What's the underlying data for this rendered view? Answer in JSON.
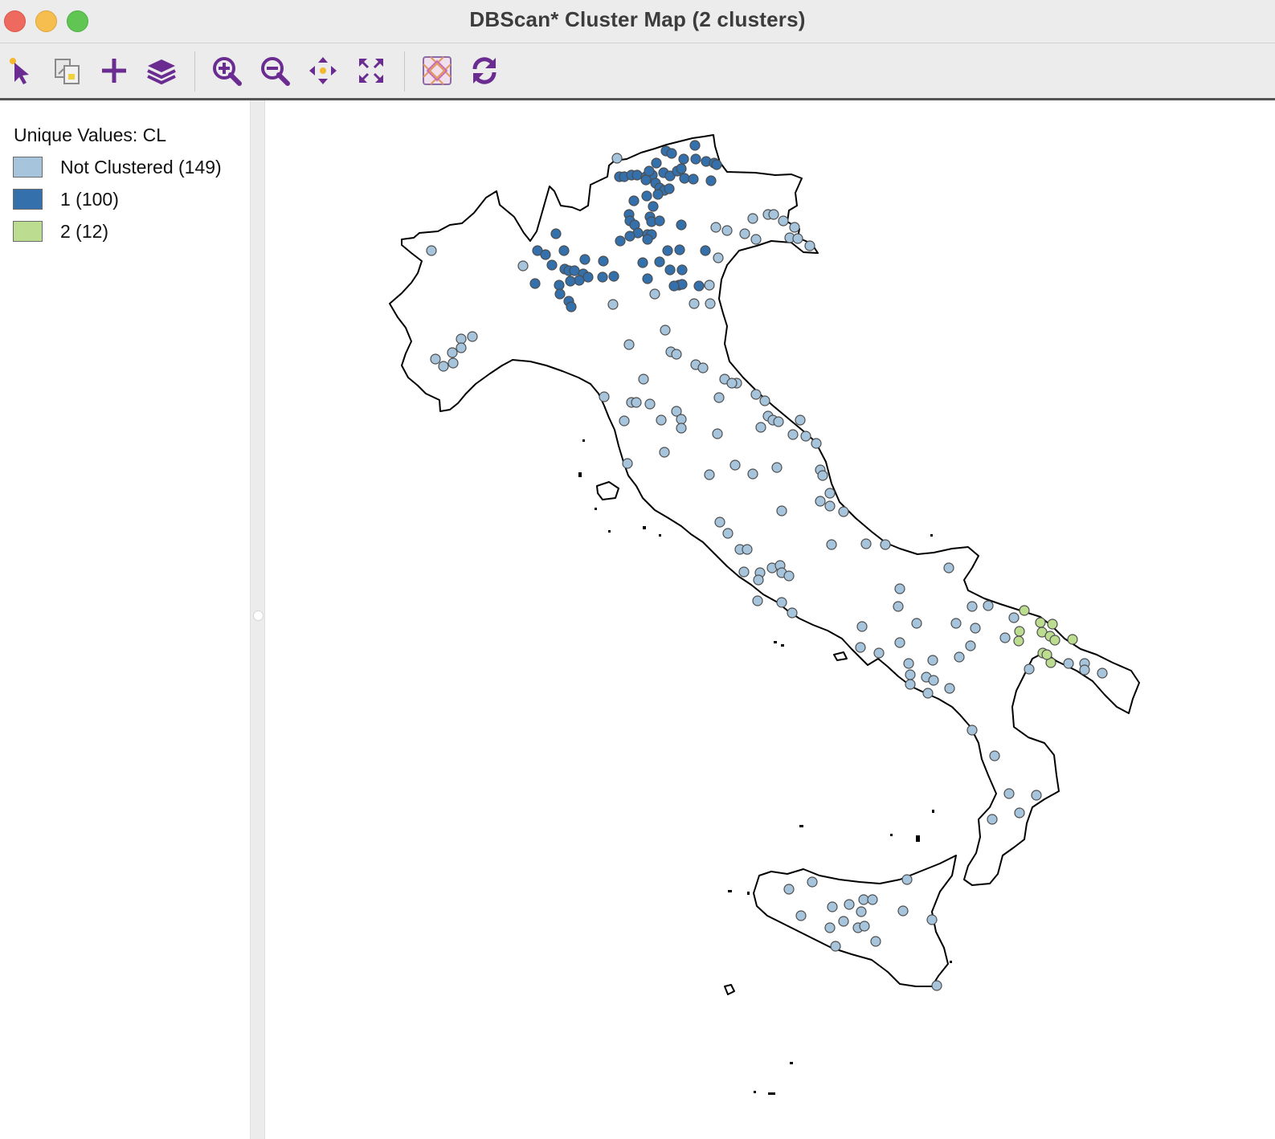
{
  "window": {
    "title": "DBScan* Cluster Map (2 clusters)"
  },
  "toolbar": {
    "tools": [
      {
        "icon": "select-pointer-icon",
        "label": "Select"
      },
      {
        "icon": "copy-image-icon",
        "label": "Copy"
      },
      {
        "icon": "add-icon",
        "label": "Add"
      },
      {
        "icon": "layers-icon",
        "label": "Layers"
      },
      {
        "icon": "zoom-in-icon",
        "label": "Zoom In"
      },
      {
        "icon": "zoom-out-icon",
        "label": "Zoom Out"
      },
      {
        "icon": "pan-icon",
        "label": "Pan"
      },
      {
        "icon": "fit-extent-icon",
        "label": "Full Extent"
      },
      {
        "icon": "basemap-icon",
        "label": "Basemap"
      },
      {
        "icon": "refresh-icon",
        "label": "Refresh"
      }
    ],
    "icon_color": "#6a2c91"
  },
  "legend": {
    "title": "Unique Values: CL",
    "items": [
      {
        "label": "Not Clustered (149)",
        "color": "#a6c5dc"
      },
      {
        "label": "1 (100)",
        "color": "#3470ac"
      },
      {
        "label": "2 (12)",
        "color": "#bcdc90"
      }
    ]
  },
  "map": {
    "outline_color": "#000000",
    "point_stroke": "#4d4d4d"
  }
}
